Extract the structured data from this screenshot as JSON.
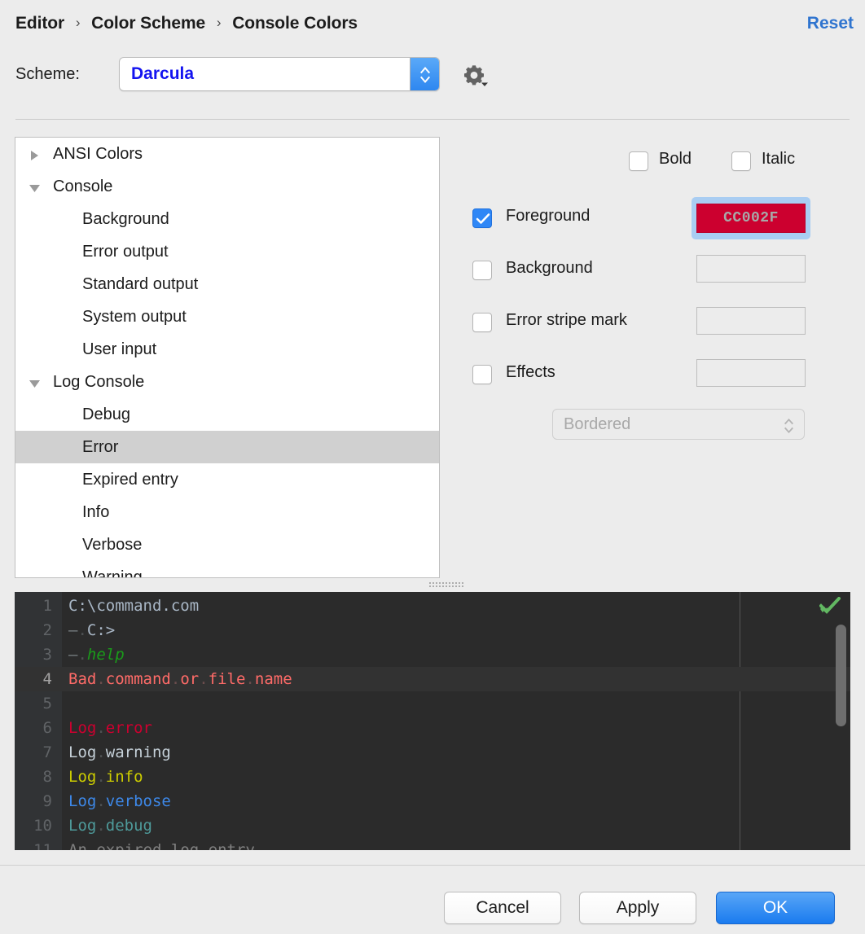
{
  "header": {
    "breadcrumb": [
      "Editor",
      "Color Scheme",
      "Console Colors"
    ],
    "separator": "›",
    "reset_label": "Reset",
    "reset_color": "#2f74cf"
  },
  "scheme": {
    "label": "Scheme:",
    "value": "Darcula",
    "value_color": "#1414f0",
    "gear_icon": "gear-icon"
  },
  "tree": {
    "items": [
      {
        "label": "ANSI Colors",
        "level": 0,
        "twisty": "collapsed",
        "selected": false
      },
      {
        "label": "Console",
        "level": 0,
        "twisty": "expanded",
        "selected": false
      },
      {
        "label": "Background",
        "level": 1,
        "twisty": "none",
        "selected": false
      },
      {
        "label": "Error output",
        "level": 1,
        "twisty": "none",
        "selected": false
      },
      {
        "label": "Standard output",
        "level": 1,
        "twisty": "none",
        "selected": false
      },
      {
        "label": "System output",
        "level": 1,
        "twisty": "none",
        "selected": false
      },
      {
        "label": "User input",
        "level": 1,
        "twisty": "none",
        "selected": false
      },
      {
        "label": "Log Console",
        "level": 0,
        "twisty": "expanded",
        "selected": false
      },
      {
        "label": "Debug",
        "level": 1,
        "twisty": "none",
        "selected": false
      },
      {
        "label": "Error",
        "level": 1,
        "twisty": "none",
        "selected": true
      },
      {
        "label": "Expired entry",
        "level": 1,
        "twisty": "none",
        "selected": false
      },
      {
        "label": "Info",
        "level": 1,
        "twisty": "none",
        "selected": false
      },
      {
        "label": "Verbose",
        "level": 1,
        "twisty": "none",
        "selected": false
      },
      {
        "label": "Warning",
        "level": 1,
        "twisty": "none",
        "selected": false
      }
    ]
  },
  "attributes": {
    "bold": {
      "label": "Bold",
      "checked": false
    },
    "italic": {
      "label": "Italic",
      "checked": false
    },
    "foreground": {
      "label": "Foreground",
      "checked": true,
      "value": "CC002F",
      "swatch_color": "#CC002F"
    },
    "background": {
      "label": "Background",
      "checked": false,
      "value": ""
    },
    "error_stripe": {
      "label": "Error stripe mark",
      "checked": false,
      "value": ""
    },
    "effects": {
      "label": "Effects",
      "checked": false,
      "value": ""
    },
    "effect_type": {
      "value": "Bordered",
      "disabled": true
    }
  },
  "console_preview": {
    "lines": [
      {
        "num": "1",
        "current": false,
        "parts": [
          {
            "t": "C:\\command.com",
            "c": "#a9b7c6"
          }
        ]
      },
      {
        "num": "2",
        "current": false,
        "parts": [
          {
            "t": "–",
            "c": "#7a8184"
          },
          {
            "t": ".",
            "c": "#4d5152"
          },
          {
            "t": "C:>",
            "c": "#a9b7c6"
          }
        ]
      },
      {
        "num": "3",
        "current": false,
        "parts": [
          {
            "t": "–",
            "c": "#7a8184"
          },
          {
            "t": ".",
            "c": "#4d5152"
          },
          {
            "t": "help",
            "c": "#1a9b1a",
            "i": true
          }
        ]
      },
      {
        "num": "4",
        "current": true,
        "parts": [
          {
            "t": "Bad",
            "c": "#ff6b68"
          },
          {
            "t": ".",
            "c": "#6b4d4d"
          },
          {
            "t": "command",
            "c": "#ff6b68"
          },
          {
            "t": ".",
            "c": "#6b4d4d"
          },
          {
            "t": "or",
            "c": "#ff6b68"
          },
          {
            "t": ".",
            "c": "#6b4d4d"
          },
          {
            "t": "file",
            "c": "#ff6b68"
          },
          {
            "t": ".",
            "c": "#6b4d4d"
          },
          {
            "t": "name",
            "c": "#ff6b68"
          }
        ]
      },
      {
        "num": "5",
        "current": false,
        "parts": [
          {
            "t": "",
            "c": "#a9b7c6"
          }
        ]
      },
      {
        "num": "6",
        "current": false,
        "parts": [
          {
            "t": "Log",
            "c": "#cc002f"
          },
          {
            "t": ".",
            "c": "#4d5152"
          },
          {
            "t": "error",
            "c": "#cc002f"
          }
        ]
      },
      {
        "num": "7",
        "current": false,
        "parts": [
          {
            "t": "Log",
            "c": "#c5d0d8"
          },
          {
            "t": ".",
            "c": "#4d5152"
          },
          {
            "t": "warning",
            "c": "#c5d0d8"
          }
        ]
      },
      {
        "num": "8",
        "current": false,
        "parts": [
          {
            "t": "Log",
            "c": "#cccc00"
          },
          {
            "t": ".",
            "c": "#4d5152"
          },
          {
            "t": "info",
            "c": "#cccc00"
          }
        ]
      },
      {
        "num": "9",
        "current": false,
        "parts": [
          {
            "t": "Log",
            "c": "#3d88e8"
          },
          {
            "t": ".",
            "c": "#4d5152"
          },
          {
            "t": "verbose",
            "c": "#3d88e8"
          }
        ]
      },
      {
        "num": "10",
        "current": false,
        "parts": [
          {
            "t": "Log",
            "c": "#4e9a9a"
          },
          {
            "t": ".",
            "c": "#4d5152"
          },
          {
            "t": "debug",
            "c": "#4e9a9a"
          }
        ]
      },
      {
        "num": "11",
        "current": false,
        "parts": [
          {
            "t": "An",
            "c": "#808080"
          },
          {
            "t": ".",
            "c": "#4d5152"
          },
          {
            "t": "expired",
            "c": "#808080"
          },
          {
            "t": ".",
            "c": "#4d5152"
          },
          {
            "t": "log",
            "c": "#808080"
          },
          {
            "t": ".",
            "c": "#4d5152"
          },
          {
            "t": "entry",
            "c": "#808080"
          }
        ]
      }
    ],
    "inspection_icon": "green-check-icon",
    "background_color": "#2b2b2b",
    "gutter_color": "#313335"
  },
  "buttons": {
    "cancel": "Cancel",
    "apply": "Apply",
    "ok": "OK",
    "ok_accent": "#1a7bef"
  }
}
